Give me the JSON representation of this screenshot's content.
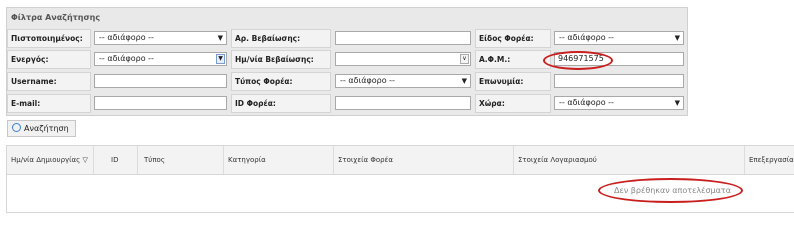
{
  "filters": {
    "title": "Φίλτρα Αναζήτησης",
    "rows": [
      [
        {
          "label": "Πιστοποιημένος:",
          "kind": "select",
          "value": "-- αδιάφορο --"
        },
        {
          "label": "Αρ. Βεβαίωσης:",
          "kind": "input",
          "value": ""
        },
        {
          "label": "Είδος Φορέα:",
          "kind": "select",
          "value": "-- αδιάφορο --"
        }
      ],
      [
        {
          "label": "Ενεργός:",
          "kind": "select",
          "value": "-- αδιάφορο --"
        },
        {
          "label": "Ημ/νία Βεβαίωσης:",
          "kind": "date",
          "value": ""
        },
        {
          "label": "Α.Φ.Μ.:",
          "kind": "input",
          "value": "946971575"
        }
      ],
      [
        {
          "label": "Username:",
          "kind": "input",
          "value": ""
        },
        {
          "label": "Τύπος Φορέα:",
          "kind": "select",
          "value": "-- αδιάφορο --"
        },
        {
          "label": "Επωνυμία:",
          "kind": "input",
          "value": ""
        }
      ],
      [
        {
          "label": "E-mail:",
          "kind": "input",
          "value": ""
        },
        {
          "label": "ID Φορέα:",
          "kind": "input",
          "value": ""
        },
        {
          "label": "Χώρα:",
          "kind": "select",
          "value": "-- αδιάφορο --"
        }
      ]
    ]
  },
  "search_button": {
    "label": "Αναζήτηση",
    "icon": "search-icon"
  },
  "grid": {
    "columns": [
      "Ημ/νία Δημιουργίας",
      "ID",
      "Τύπος",
      "Κατηγορία",
      "Στοιχεία Φορέα",
      "Στοιχεία Λογαριασμού",
      "Επεξεργασία"
    ],
    "sort_indicator": "▽",
    "empty_message": "Δεν βρέθηκαν αποτελέσματα"
  },
  "colors": {
    "annotation": "#c81e1e",
    "accent": "#3a7fd5"
  }
}
